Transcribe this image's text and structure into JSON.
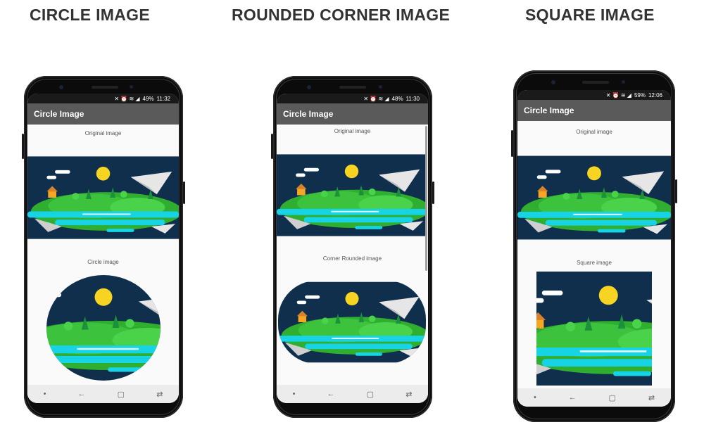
{
  "headings": {
    "circle": "CIRCLE IMAGE",
    "rounded": "ROUNDED CORNER IMAGE",
    "square": "SQUARE IMAGE"
  },
  "phones": [
    {
      "status": {
        "icons": "✕ ⏰ ≋ ◢",
        "battery": "49%",
        "time": "11:32"
      },
      "app_title": "Circle Image",
      "caption_top": "Original image",
      "caption_bottom": "Circle image"
    },
    {
      "status": {
        "icons": "✕ ⏰ ≋ ◢",
        "battery": "48%",
        "time": "11:30"
      },
      "app_title": "Circle Image",
      "caption_top": "Original image",
      "caption_bottom": "Corner Rounded image"
    },
    {
      "status": {
        "icons": "✕ ⏰ ≋ ◢",
        "battery": "59%",
        "time": "12:06"
      },
      "app_title": "Circle Image",
      "caption_top": "Original image",
      "caption_bottom": "Square image"
    }
  ],
  "navbar": {
    "dot": "•",
    "back": "←",
    "home": "▢",
    "recent": "⇄"
  },
  "colors": {
    "appbar": "#5a5a5a",
    "sky": "#0f2f4d",
    "hill": "#3cc23c",
    "water": "#17d3e6",
    "sun": "#f7d322",
    "house": "#f5a623"
  }
}
